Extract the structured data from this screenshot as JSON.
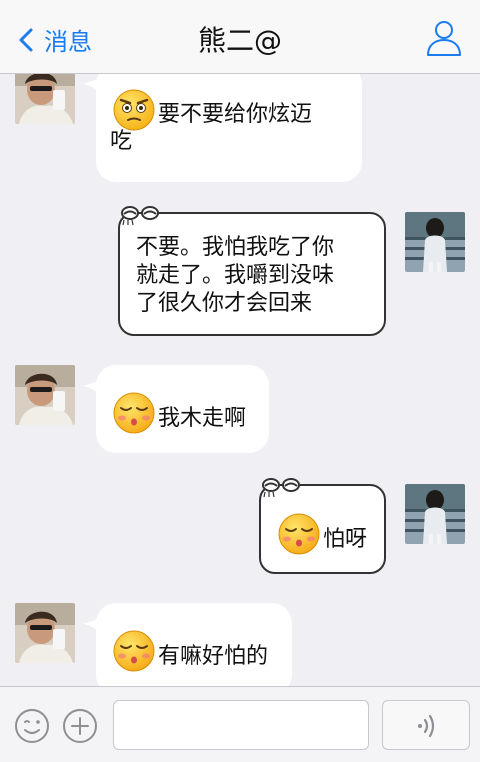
{
  "header": {
    "back_label": "消息",
    "title": "熊二@"
  },
  "messages": [
    {
      "side": "in",
      "text_line1": "要不要给你炫迈",
      "text_line2": "吃",
      "emoji": "frown-emoji"
    },
    {
      "side": "out",
      "lines": [
        " 不要。我怕我吃了你",
        "就走了。我嚼到没味",
        "了很久你才会回来"
      ]
    },
    {
      "side": "in",
      "text": "我木走啊",
      "emoji": "kiss-emoji"
    },
    {
      "side": "out",
      "text": "怕呀",
      "emoji": "kiss-emoji"
    },
    {
      "side": "in",
      "text": "有嘛好怕的",
      "emoji": "kiss-emoji"
    }
  ],
  "input": {
    "value": "",
    "placeholder": ""
  },
  "colors": {
    "accent": "#1a7cf0",
    "background": "#efeff4",
    "bubble": "#ffffff"
  }
}
